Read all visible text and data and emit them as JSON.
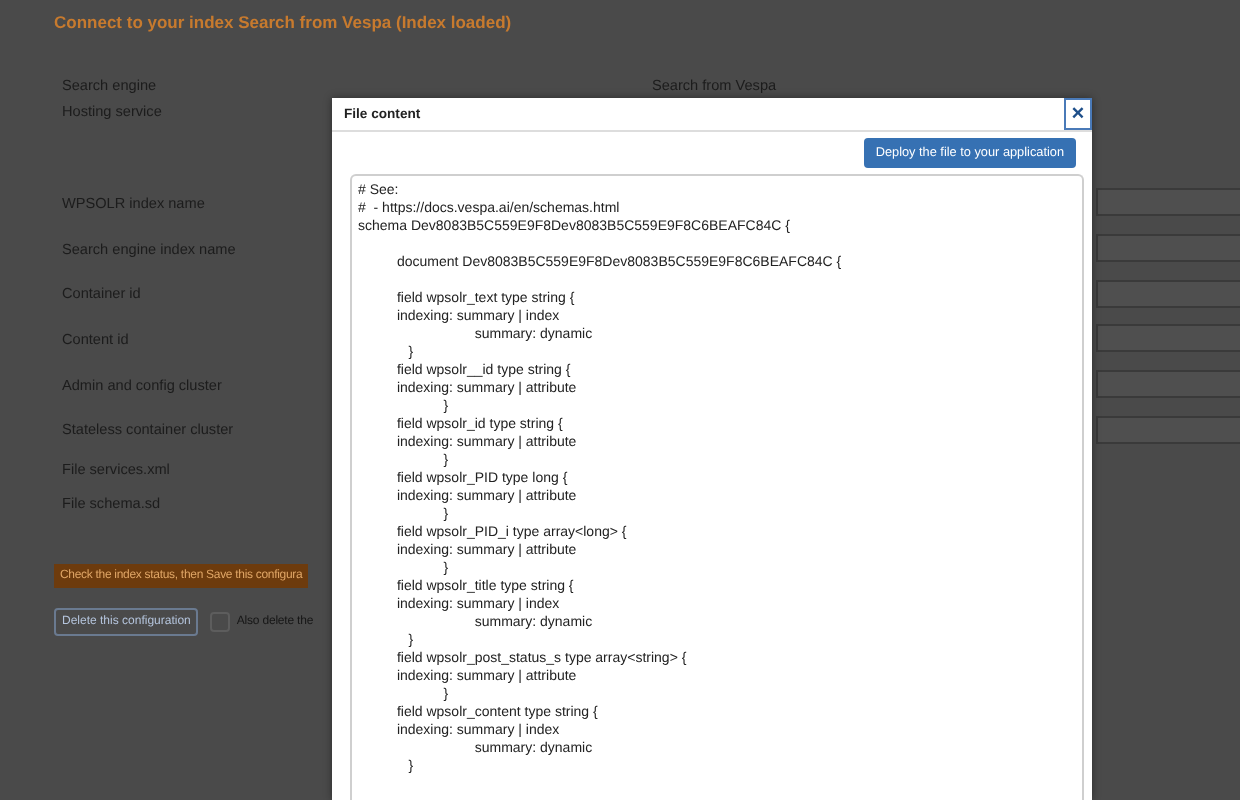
{
  "page": {
    "title": "Connect to your index Search from Vespa (Index loaded)",
    "rows": [
      {
        "label": "Search engine",
        "kind": "text",
        "value": "Search from Vespa"
      },
      {
        "label": "Hosting service",
        "kind": "plain"
      },
      {
        "label": "WPSOLR index name",
        "kind": "field"
      },
      {
        "label": "Search engine index name",
        "kind": "field"
      },
      {
        "label": "Container id",
        "kind": "field"
      },
      {
        "label": "Content id",
        "kind": "field"
      },
      {
        "label": "Admin and config cluster",
        "kind": "field"
      },
      {
        "label": "Stateless container cluster",
        "kind": "field"
      },
      {
        "label": "File services.xml",
        "kind": "plain"
      },
      {
        "label": "File schema.sd",
        "kind": "plain"
      }
    ],
    "check_button": "Check the index status, then Save this configura",
    "delete_button": "Delete this configuration",
    "also_delete": {
      "label": "Also delete the",
      "checked": false
    }
  },
  "dialog": {
    "title": "File content",
    "close": "×",
    "deploy_button": "Deploy the file to your application",
    "content": "# See:\n#  - https://docs.vespa.ai/en/schemas.html\nschema Dev8083B5C559E9F8Dev8083B5C559E9F8C6BEAFC84C {\n\n          document Dev8083B5C559E9F8Dev8083B5C559E9F8C6BEAFC84C {\n\n          field wpsolr_text type string {\n          indexing: summary | index\n                              summary: dynamic\n             }\n          field wpsolr__id type string {\n          indexing: summary | attribute\n                      }\n          field wpsolr_id type string {\n          indexing: summary | attribute\n                      }\n          field wpsolr_PID type long {\n          indexing: summary | attribute\n                      }\n          field wpsolr_PID_i type array<long> {\n          indexing: summary | attribute\n                      }\n          field wpsolr_title type string {\n          indexing: summary | index\n                              summary: dynamic\n             }\n          field wpsolr_post_status_s type array<string> {\n          indexing: summary | attribute\n                      }\n          field wpsolr_content type string {\n          indexing: summary | index\n                              summary: dynamic\n             }"
  }
}
